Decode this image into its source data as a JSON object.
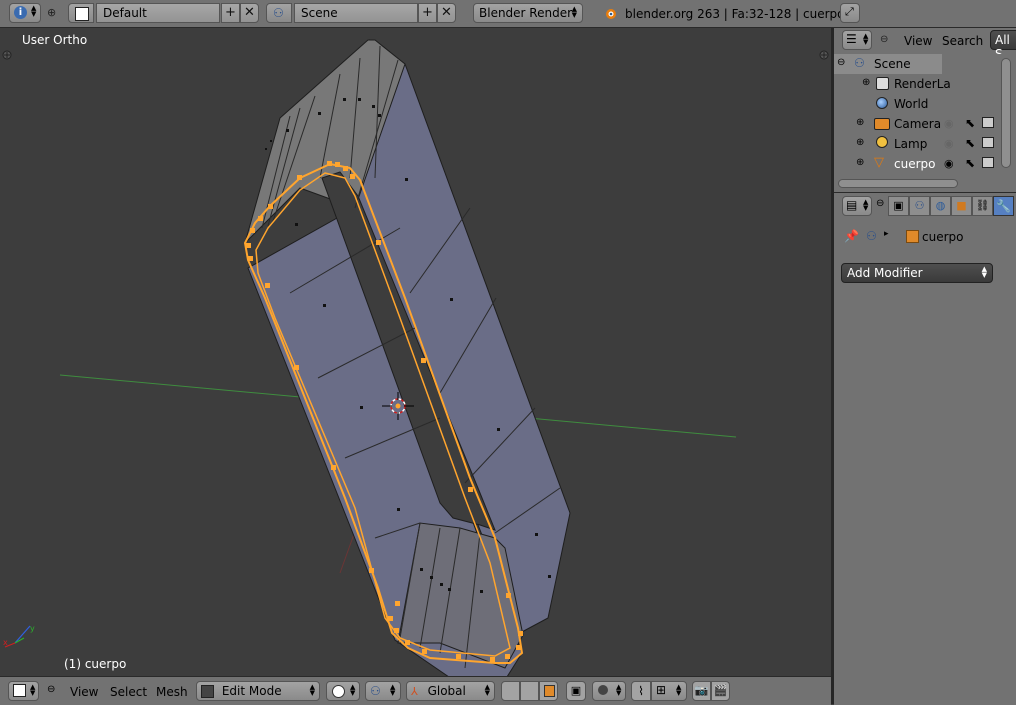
{
  "header": {
    "layout_name": "Default",
    "scene_name": "Scene",
    "render_engine": "Blender Render",
    "info_text": "blender.org 263 | Fa:32-128 | cuerpo"
  },
  "viewport": {
    "view_label": "User Ortho",
    "object_label": "(1) cuerpo"
  },
  "outliner": {
    "menu_view": "View",
    "menu_search": "Search",
    "filter_label": "All S",
    "items": [
      {
        "label": "Scene"
      },
      {
        "label": "RenderLa"
      },
      {
        "label": "World"
      },
      {
        "label": "Camera"
      },
      {
        "label": "Lamp"
      },
      {
        "label": "cuerpo"
      }
    ]
  },
  "properties": {
    "breadcrumb_object": "cuerpo",
    "add_modifier_label": "Add Modifier"
  },
  "footer": {
    "menu_view": "View",
    "menu_select": "Select",
    "menu_mesh": "Mesh",
    "mode": "Edit Mode",
    "orientation": "Global"
  },
  "colors": {
    "selection": "#ffa52e",
    "mesh_face": "#6a6d85",
    "viewport_bg": "#3d3d3d",
    "panel_bg": "#727272"
  }
}
